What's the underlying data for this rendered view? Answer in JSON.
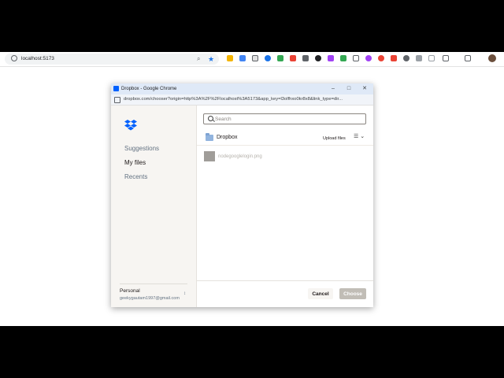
{
  "browser": {
    "url": "localhost:5173",
    "zoom_icon": "zoom-icon",
    "bookmark_icon": "star-icon",
    "extension_colors": [
      "#f4b400",
      "#4285f4",
      "#5f6368",
      "#1a73e8",
      "#34a853",
      "#ea4335",
      "#5f6368",
      "#202124",
      "#a142f4",
      "#34a853",
      "#5f6368",
      "#a142f4",
      "#ea4335",
      "#ea4335",
      "#5f6368",
      "#5f6368",
      "#5f6368",
      "#5f6368"
    ]
  },
  "popup": {
    "title": "Dropbox - Google Chrome",
    "url": "dropbox.com/chooser?origin=http%3A%2F%2Flocalhost%3A5173&app_key=l3olfhxo0kr8x8&link_type=dir...",
    "sidebar": {
      "items": [
        {
          "label": "Suggestions",
          "active": false
        },
        {
          "label": "My files",
          "active": true
        },
        {
          "label": "Recents",
          "active": false
        }
      ],
      "account_type": "Personal",
      "account_email": "geekygautam1997@gmail.com"
    },
    "main": {
      "search_placeholder": "Search",
      "breadcrumb": "Dropbox",
      "upload_label": "Upload files",
      "files": [
        {
          "name": "nodegooglelogin.png"
        }
      ],
      "cancel_label": "Cancel",
      "choose_label": "Choose"
    },
    "colors": {
      "accent": "#0061fe",
      "sidebar_bg": "#f7f5f2",
      "choose_disabled": "#c1bdb6"
    }
  }
}
